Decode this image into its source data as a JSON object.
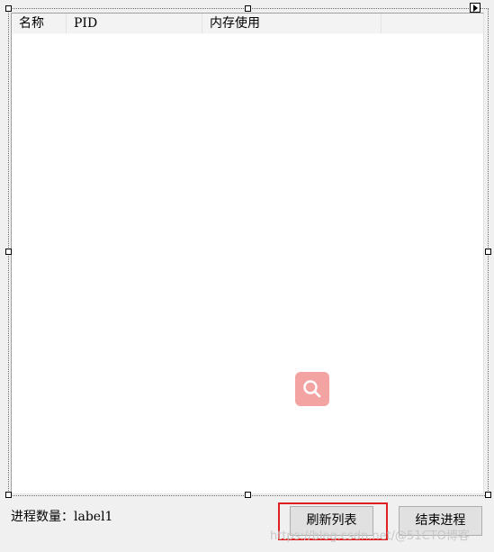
{
  "list": {
    "columns": [
      "名称",
      "PID",
      "内存使用",
      ""
    ]
  },
  "status": {
    "prefix": "进程数量：",
    "value": "label1"
  },
  "buttons": {
    "refresh": "刷新列表",
    "kill": "结束进程"
  },
  "watermark": "https://blog.csdn.net/@51CTO博客",
  "colors": {
    "highlight": "#e02020",
    "search_badge": "#f4a3a3"
  }
}
